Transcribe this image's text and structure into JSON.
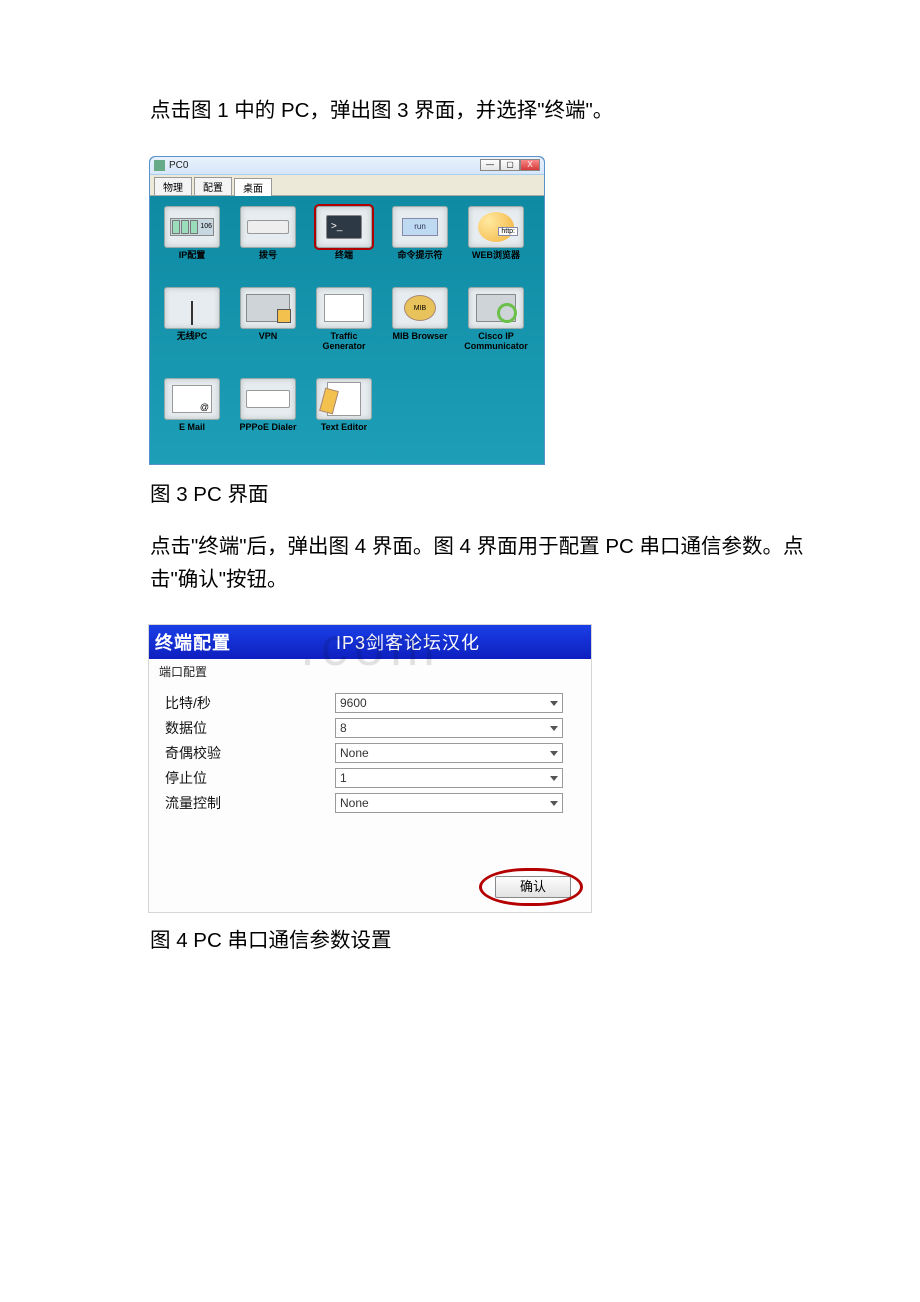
{
  "para1": "点击图 1 中的 PC，弹出图 3 界面，并选择\"终端\"。",
  "fig3_caption": "图 3 PC 界面",
  "para2": "点击\"终端\"后，弹出图 4 界面。图 4 界面用于配置 PC 串口通信参数。点击\"确认\"按钮。",
  "fig4_caption": "图 4  PC 串口通信参数设置",
  "watermark": ".com",
  "pcwin": {
    "title": "PC0",
    "btn_min": "—",
    "btn_max": "▢",
    "btn_close": "X",
    "tabs": {
      "t1": "物理",
      "t2": "配置",
      "t3": "桌面"
    },
    "icons": [
      {
        "name": "ip-config",
        "label": "IP配置",
        "num": "106"
      },
      {
        "name": "dial",
        "label": "拨号"
      },
      {
        "name": "terminal",
        "label": "终端",
        "gly": ">_"
      },
      {
        "name": "cmd",
        "label": "命令提示符",
        "gly": "run"
      },
      {
        "name": "web",
        "label": "WEB浏览器"
      },
      {
        "name": "wifi-pc",
        "label": "无线PC"
      },
      {
        "name": "vpn",
        "label": "VPN"
      },
      {
        "name": "traffic",
        "label": "Traffic\nGenerator"
      },
      {
        "name": "mib",
        "label": "MIB Browser",
        "gly": "MIB"
      },
      {
        "name": "ciscoip",
        "label": "Cisco IP\nCommunicator"
      },
      {
        "name": "email",
        "label": "E Mail"
      },
      {
        "name": "pppoe",
        "label": "PPPoE Dialer"
      },
      {
        "name": "texteditor",
        "label": "Text Editor"
      }
    ]
  },
  "term": {
    "hdr_left": "终端配置",
    "hdr_mid": "IP3剑客论坛汉化",
    "group": "端口配置",
    "rows": [
      {
        "label": "比特/秒",
        "value": "9600"
      },
      {
        "label": "数据位",
        "value": "8"
      },
      {
        "label": "奇偶校验",
        "value": "None"
      },
      {
        "label": "停止位",
        "value": "1"
      },
      {
        "label": "流量控制",
        "value": "None"
      }
    ],
    "ok": "确认"
  }
}
